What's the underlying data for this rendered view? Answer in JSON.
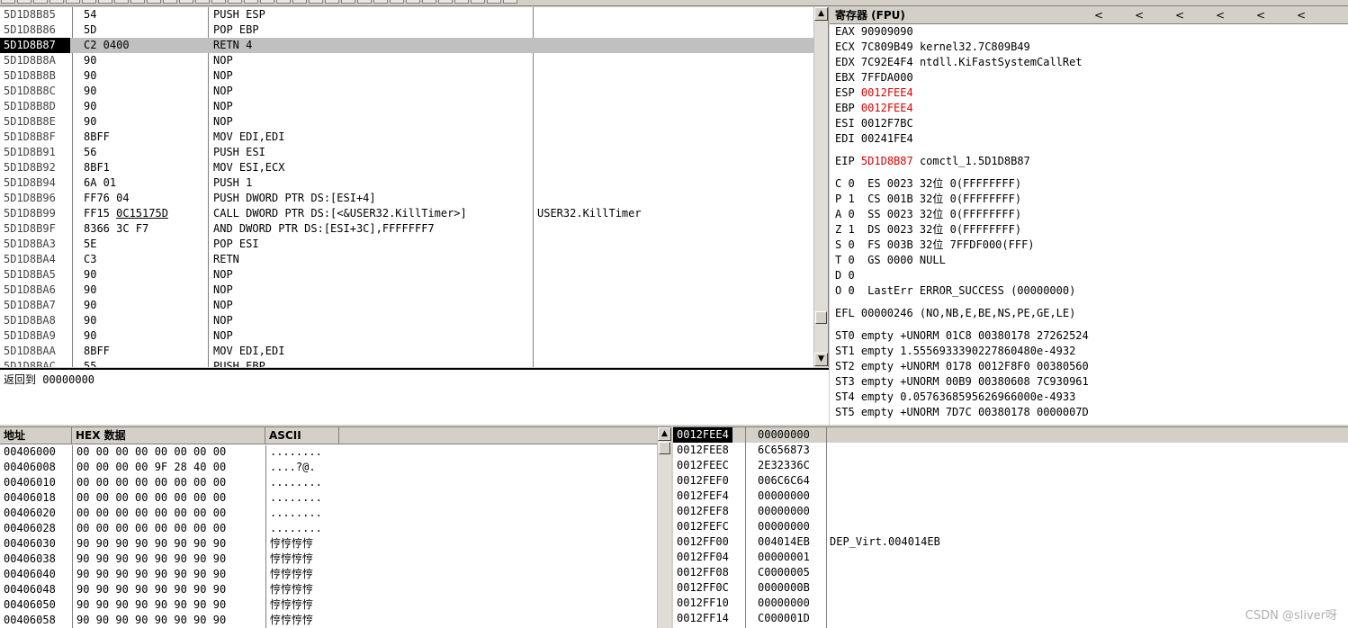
{
  "disasm": {
    "selected_index": 2,
    "rows": [
      {
        "addr": "5D1D8B85",
        "hex": "54",
        "ins": "PUSH ESP",
        "cmt": ""
      },
      {
        "addr": "5D1D8B86",
        "hex": "5D",
        "ins": "POP EBP",
        "cmt": ""
      },
      {
        "addr": "5D1D8B87",
        "hex": "C2 0400",
        "ins": "RETN 4",
        "cmt": ""
      },
      {
        "addr": "5D1D8B8A",
        "hex": "90",
        "ins": "NOP",
        "cmt": ""
      },
      {
        "addr": "5D1D8B8B",
        "hex": "90",
        "ins": "NOP",
        "cmt": ""
      },
      {
        "addr": "5D1D8B8C",
        "hex": "90",
        "ins": "NOP",
        "cmt": ""
      },
      {
        "addr": "5D1D8B8D",
        "hex": "90",
        "ins": "NOP",
        "cmt": ""
      },
      {
        "addr": "5D1D8B8E",
        "hex": "90",
        "ins": "NOP",
        "cmt": ""
      },
      {
        "addr": "5D1D8B8F",
        "hex": "8BFF",
        "ins": "MOV EDI,EDI",
        "cmt": ""
      },
      {
        "addr": "5D1D8B91",
        "hex": "56",
        "ins": "PUSH ESI",
        "cmt": ""
      },
      {
        "addr": "5D1D8B92",
        "hex": "8BF1",
        "ins": "MOV ESI,ECX",
        "cmt": ""
      },
      {
        "addr": "5D1D8B94",
        "hex": "6A 01",
        "ins": "PUSH 1",
        "cmt": ""
      },
      {
        "addr": "5D1D8B96",
        "hex": "FF76 04",
        "ins": "PUSH DWORD PTR DS:[ESI+4]",
        "cmt": ""
      },
      {
        "addr": "5D1D8B99",
        "hex": "FF15 0C15175D",
        "ins": "CALL DWORD PTR DS:[<&USER32.KillTimer>]",
        "cmt": "USER32.KillTimer"
      },
      {
        "addr": "5D1D8B9F",
        "hex": "8366 3C F7",
        "ins": "AND DWORD PTR DS:[ESI+3C],FFFFFFF7",
        "cmt": ""
      },
      {
        "addr": "5D1D8BA3",
        "hex": "5E",
        "ins": "POP ESI",
        "cmt": ""
      },
      {
        "addr": "5D1D8BA4",
        "hex": "C3",
        "ins": "RETN",
        "cmt": ""
      },
      {
        "addr": "5D1D8BA5",
        "hex": "90",
        "ins": "NOP",
        "cmt": ""
      },
      {
        "addr": "5D1D8BA6",
        "hex": "90",
        "ins": "NOP",
        "cmt": ""
      },
      {
        "addr": "5D1D8BA7",
        "hex": "90",
        "ins": "NOP",
        "cmt": ""
      },
      {
        "addr": "5D1D8BA8",
        "hex": "90",
        "ins": "NOP",
        "cmt": ""
      },
      {
        "addr": "5D1D8BA9",
        "hex": "90",
        "ins": "NOP",
        "cmt": ""
      },
      {
        "addr": "5D1D8BAA",
        "hex": "8BFF",
        "ins": "MOV EDI,EDI",
        "cmt": ""
      },
      {
        "addr": "5D1D8BAC",
        "hex": "55",
        "ins": "PUSH EBP",
        "cmt": ""
      }
    ]
  },
  "info": {
    "text": "返回到 00000000"
  },
  "registers": {
    "title": "寄存器 (FPU)",
    "arrows": [
      "<",
      "<",
      "<",
      "<",
      "<",
      "<"
    ],
    "gp": [
      {
        "name": "EAX",
        "value": "90909090",
        "comment": "",
        "changed": false
      },
      {
        "name": "ECX",
        "value": "7C809B49",
        "comment": "kernel32.7C809B49",
        "changed": false
      },
      {
        "name": "EDX",
        "value": "7C92E4F4",
        "comment": "ntdll.KiFastSystemCallRet",
        "changed": false
      },
      {
        "name": "EBX",
        "value": "7FFDA000",
        "comment": "",
        "changed": false
      },
      {
        "name": "ESP",
        "value": "0012FEE4",
        "comment": "",
        "changed": true
      },
      {
        "name": "EBP",
        "value": "0012FEE4",
        "comment": "",
        "changed": true
      },
      {
        "name": "ESI",
        "value": "0012F7BC",
        "comment": "",
        "changed": false
      },
      {
        "name": "EDI",
        "value": "00241FE4",
        "comment": "",
        "changed": false
      }
    ],
    "eip": {
      "name": "EIP",
      "value": "5D1D8B87",
      "comment": "comctl_1.5D1D8B87"
    },
    "flags": [
      "C 0  ES 0023 32位 0(FFFFFFFF)",
      "P 1  CS 001B 32位 0(FFFFFFFF)",
      "A 0  SS 0023 32位 0(FFFFFFFF)",
      "Z 1  DS 0023 32位 0(FFFFFFFF)",
      "S 0  FS 003B 32位 7FFDF000(FFF)",
      "T 0  GS 0000 NULL",
      "D 0",
      "O 0  LastErr ERROR_SUCCESS (00000000)"
    ],
    "efl": "EFL 00000246 (NO,NB,E,BE,NS,PE,GE,LE)",
    "fpu": [
      "ST0 empty +UNORM 01C8 00380178 27262524",
      "ST1 empty 1.5556933390227860480e-4932",
      "ST2 empty +UNORM 0178 0012F8F0 00380560",
      "ST3 empty +UNORM 00B9 00380608 7C930961",
      "ST4 empty 0.0576368595626966000e-4933",
      "ST5 empty +UNORM 7D7C 00380178 0000007D"
    ]
  },
  "dump": {
    "headers": {
      "addr": "地址",
      "hex": "HEX 数据",
      "ascii": "ASCII"
    },
    "rows": [
      {
        "addr": "00406000",
        "hex": "00 00 00 00 00 00 00 00",
        "ascii": "........"
      },
      {
        "addr": "00406008",
        "hex": "00 00 00 00 9F 28 40 00",
        "ascii": "....?@."
      },
      {
        "addr": "00406010",
        "hex": "00 00 00 00 00 00 00 00",
        "ascii": "........"
      },
      {
        "addr": "00406018",
        "hex": "00 00 00 00 00 00 00 00",
        "ascii": "........"
      },
      {
        "addr": "00406020",
        "hex": "00 00 00 00 00 00 00 00",
        "ascii": "........"
      },
      {
        "addr": "00406028",
        "hex": "00 00 00 00 00 00 00 00",
        "ascii": "........"
      },
      {
        "addr": "00406030",
        "hex": "90 90 90 90 90 90 90 90",
        "ascii": "悙悙悙悙"
      },
      {
        "addr": "00406038",
        "hex": "90 90 90 90 90 90 90 90",
        "ascii": "悙悙悙悙"
      },
      {
        "addr": "00406040",
        "hex": "90 90 90 90 90 90 90 90",
        "ascii": "悙悙悙悙"
      },
      {
        "addr": "00406048",
        "hex": "90 90 90 90 90 90 90 90",
        "ascii": "悙悙悙悙"
      },
      {
        "addr": "00406050",
        "hex": "90 90 90 90 90 90 90 90",
        "ascii": "悙悙悙悙"
      },
      {
        "addr": "00406058",
        "hex": "90 90 90 90 90 90 90 90",
        "ascii": "悙悙悙悙"
      }
    ]
  },
  "stack": {
    "selected_index": 0,
    "rows": [
      {
        "addr": "0012FEE4",
        "value": "00000000",
        "comment": ""
      },
      {
        "addr": "0012FEE8",
        "value": "6C656873",
        "comment": ""
      },
      {
        "addr": "0012FEEC",
        "value": "2E32336C",
        "comment": ""
      },
      {
        "addr": "0012FEF0",
        "value": "006C6C64",
        "comment": ""
      },
      {
        "addr": "0012FEF4",
        "value": "00000000",
        "comment": ""
      },
      {
        "addr": "0012FEF8",
        "value": "00000000",
        "comment": ""
      },
      {
        "addr": "0012FEFC",
        "value": "00000000",
        "comment": ""
      },
      {
        "addr": "0012FF00",
        "value": "004014EB",
        "comment": "DEP_Virt.004014EB"
      },
      {
        "addr": "0012FF04",
        "value": "00000001",
        "comment": ""
      },
      {
        "addr": "0012FF08",
        "value": "C0000005",
        "comment": ""
      },
      {
        "addr": "0012FF0C",
        "value": "0000000B",
        "comment": ""
      },
      {
        "addr": "0012FF10",
        "value": "00000000",
        "comment": ""
      },
      {
        "addr": "0012FF14",
        "value": "C000001D",
        "comment": ""
      }
    ]
  },
  "watermark": "CSDN @sliver呀"
}
